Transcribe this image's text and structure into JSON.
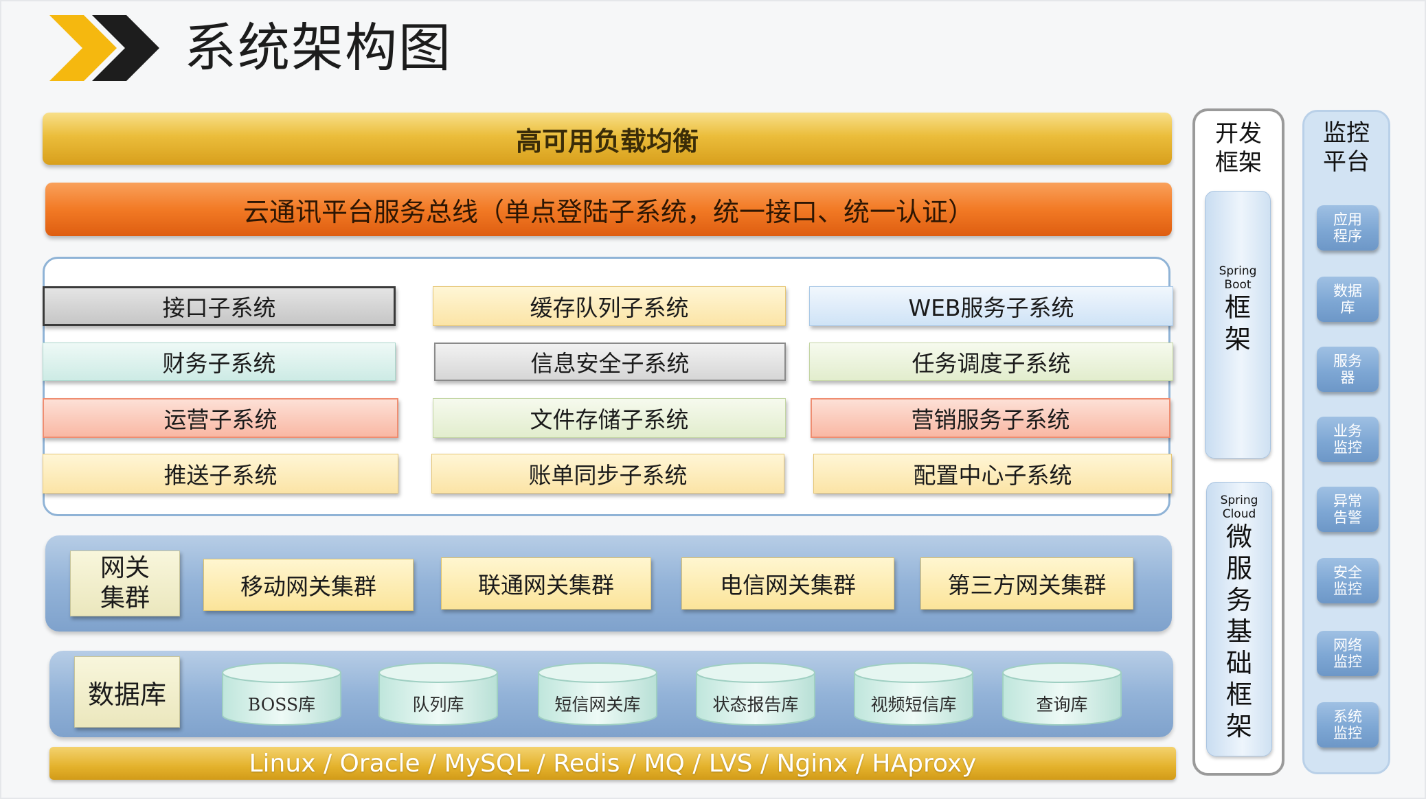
{
  "page": {
    "title": "系统架构图"
  },
  "colors": {
    "logo_front": "#f5b80f",
    "logo_back": "#1d1d1d",
    "load_balance": "#e6b433",
    "service_bus": "#f27a25",
    "band_blue": "#93b3d8",
    "monitor_button": "#7ea7d4"
  },
  "layers": {
    "load_balance": "高可用负载均衡",
    "service_bus": "云通讯平台服务总线（单点登陆子系统，统一接口、统一认证）"
  },
  "subsystems": {
    "col1": [
      "接口子系统",
      "财务子系统",
      "运营子系统",
      "推送子系统"
    ],
    "col2": [
      "缓存队列子系统",
      "信息安全子系统",
      "文件存储子系统",
      "账单同步子系统"
    ],
    "col3": [
      "WEB服务子系统",
      "任务调度子系统",
      "营销服务子系统",
      "配置中心子系统"
    ]
  },
  "gateway": {
    "label": "网关集群",
    "items": [
      "移动网关集群",
      "联通网关集群",
      "电信网关集群",
      "第三方网关集群"
    ]
  },
  "database": {
    "label": "数据库",
    "items": [
      "BOSS库",
      "队列库",
      "短信网关库",
      "状态报告库",
      "视频短信库",
      "查询库"
    ]
  },
  "tech_stack": "Linux / Oracle / MySQL / Redis / MQ / LVS / Nginx / HAproxy",
  "dev_framework": {
    "title": "开发框架",
    "spring_boot": {
      "en": "Spring Boot",
      "zh": "框架"
    },
    "spring_cloud": {
      "en": "Spring Cloud",
      "zh": "微服务基础框架"
    }
  },
  "monitor": {
    "title": "监控平台",
    "items": [
      "应用程序",
      "数据库",
      "服务器",
      "业务监控",
      "异常告警",
      "安全监控",
      "网络监控",
      "系统监控"
    ]
  }
}
